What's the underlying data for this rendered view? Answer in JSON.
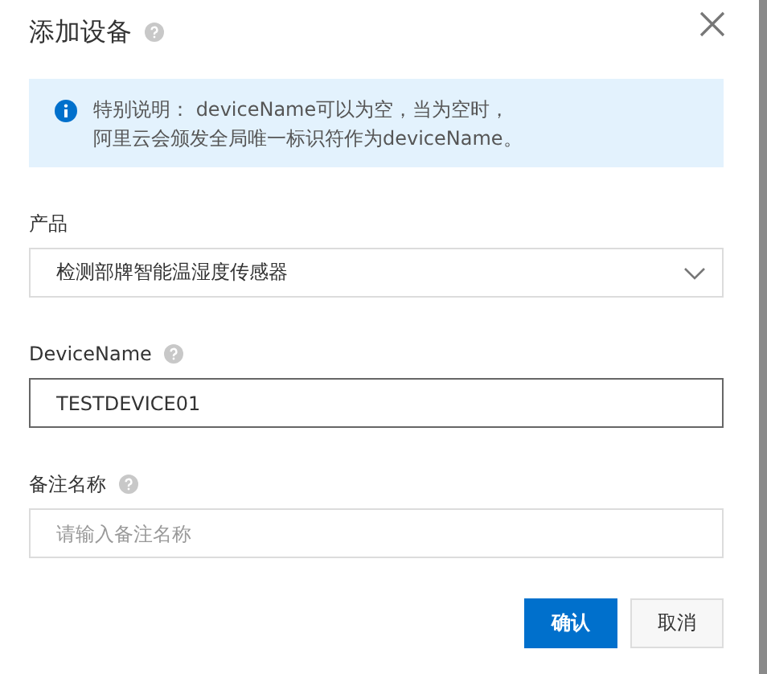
{
  "dialog": {
    "title": "添加设备",
    "title_help": true
  },
  "notice": {
    "lines": [
      "特别说明： deviceName可以为空，当为空时，",
      "阿里云会颁发全局唯一标识符作为deviceName。"
    ]
  },
  "fields": [
    {
      "kind": "select",
      "label": "产品",
      "help": false,
      "value": "检测部牌智能温湿度传感器",
      "focused": false
    },
    {
      "kind": "input",
      "label": "DeviceName",
      "help": true,
      "value": "TESTDEVICE01",
      "focused": true
    },
    {
      "kind": "input",
      "label": "备注名称",
      "help": true,
      "placeholder": "请输入备注名称",
      "focused": false
    }
  ],
  "buttons": [
    {
      "label": "确认",
      "primary": true
    },
    {
      "label": "取消",
      "primary": false
    }
  ]
}
